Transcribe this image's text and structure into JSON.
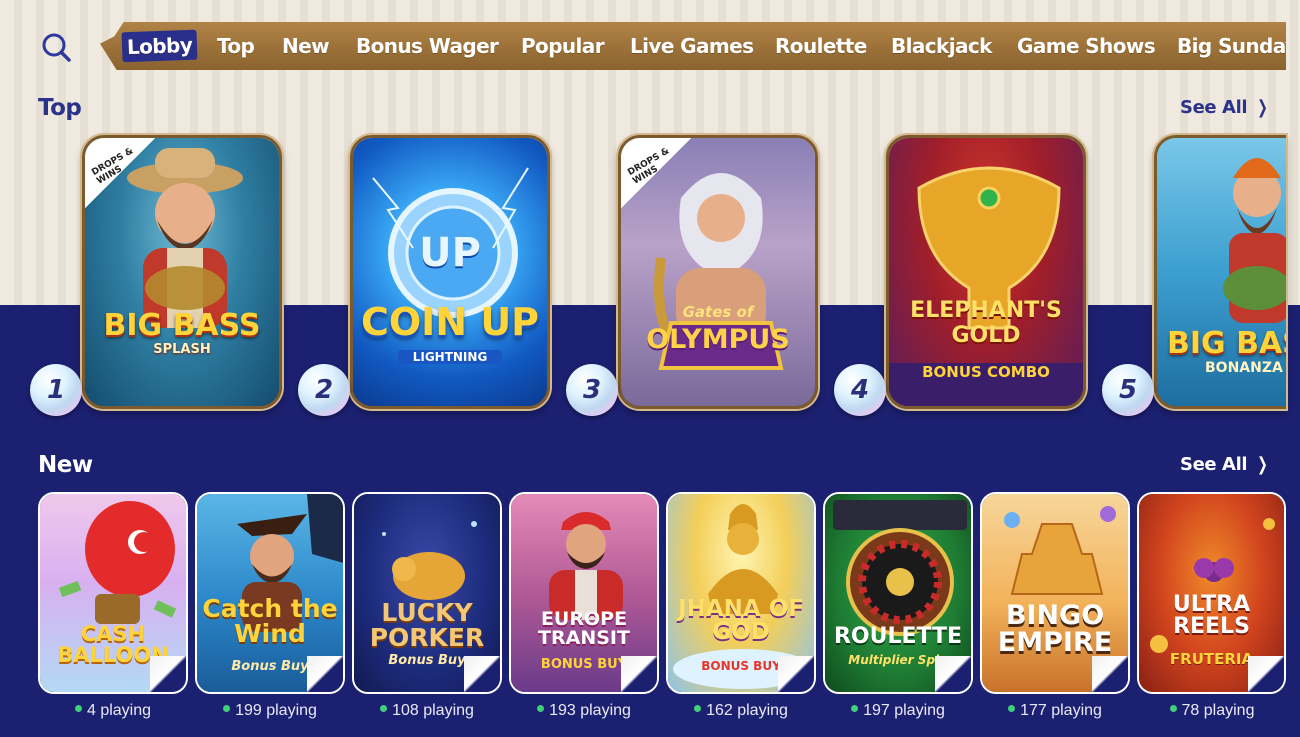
{
  "nav": {
    "search_icon": "search-icon",
    "items": [
      "Lobby",
      "Top",
      "New",
      "Bonus Wager",
      "Popular",
      "Live Games",
      "Roulette",
      "Blackjack",
      "Game Shows",
      "Big Sunday"
    ]
  },
  "top_section": {
    "title": "Top",
    "see_all": "See All",
    "games": [
      {
        "rank": "1",
        "title": "BIG BASS",
        "subtitle": "SPLASH",
        "badge": "DROPS & WINS"
      },
      {
        "rank": "2",
        "title": "COIN UP",
        "subtitle": "LIGHTNING",
        "emblem": "UP"
      },
      {
        "rank": "3",
        "title": "OLYMPUS",
        "subtitle": "Gates of",
        "badge": "DROPS & WINS"
      },
      {
        "rank": "4",
        "title": "ELEPHANT'S GOLD",
        "subtitle": "BONUS COMBO"
      },
      {
        "rank": "5",
        "title": "BIG BASS",
        "subtitle": "BONANZA"
      }
    ]
  },
  "new_section": {
    "title": "New",
    "see_all": "See All",
    "games": [
      {
        "title": "CASH BALLOON",
        "playing": "4 playing"
      },
      {
        "title": "Catch the Wind",
        "subtitle": "Bonus Buy",
        "playing": "199 playing"
      },
      {
        "title": "LUCKY PORKER",
        "subtitle": "Bonus Buy",
        "playing": "108 playing"
      },
      {
        "title": "EUROPE TRANSIT",
        "subtitle": "BONUS BUY",
        "playing": "193 playing"
      },
      {
        "title": "JHANA OF GOD",
        "subtitle": "BONUS BUY",
        "playing": "162 playing"
      },
      {
        "title": "ROULETTE",
        "subtitle": "Multiplier Spin",
        "playing": "197 playing"
      },
      {
        "title": "BINGO EMPIRE",
        "playing": "177 playing"
      },
      {
        "title": "ULTRA REELS",
        "subtitle": "FRUTERIA",
        "playing": "78 playing"
      }
    ]
  },
  "colors": {
    "navy": "#1c2070",
    "section_title_top": "#2a3289",
    "see_all_top": "#2a3289",
    "white": "#ffffff",
    "online_dot": "#3fd07a"
  }
}
